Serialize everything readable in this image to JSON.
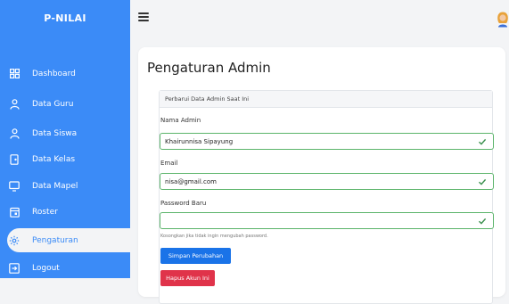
{
  "app": {
    "brand": "P-NILAI"
  },
  "sidebar": {
    "items": [
      {
        "label": "Dashboard",
        "icon": "grid-icon"
      },
      {
        "label": "Data Guru",
        "icon": "user-icon"
      },
      {
        "label": "Data Siswa",
        "icon": "user-icon"
      },
      {
        "label": "Data Kelas",
        "icon": "door-icon"
      },
      {
        "label": "Data Mapel",
        "icon": "monitor-icon"
      },
      {
        "label": "Roster",
        "icon": "calendar-icon"
      },
      {
        "label": "Pengaturan",
        "icon": "gear-icon",
        "active": true
      },
      {
        "label": "Logout",
        "icon": "logout-icon"
      }
    ]
  },
  "main": {
    "title": "Pengaturan Admin",
    "panel_title": "Perbarui Data Admin Saat Ini",
    "form": {
      "name_label": "Nama Admin",
      "name_value": "Khairunnisa Sipayung",
      "email_label": "Email",
      "email_value": "nisa@gmail.com",
      "password_label": "Password Baru",
      "password_value": "",
      "password_hint": "Kosongkan jika tidak ingin mengubah password.",
      "save_label": "Simpan Perubahan",
      "delete_label": "Hapus Akun Ini"
    }
  },
  "colors": {
    "sidebar": "#3b8bf7",
    "valid": "#5bb46a",
    "primary_button": "#1a73e8",
    "danger_button": "#e0334a"
  }
}
